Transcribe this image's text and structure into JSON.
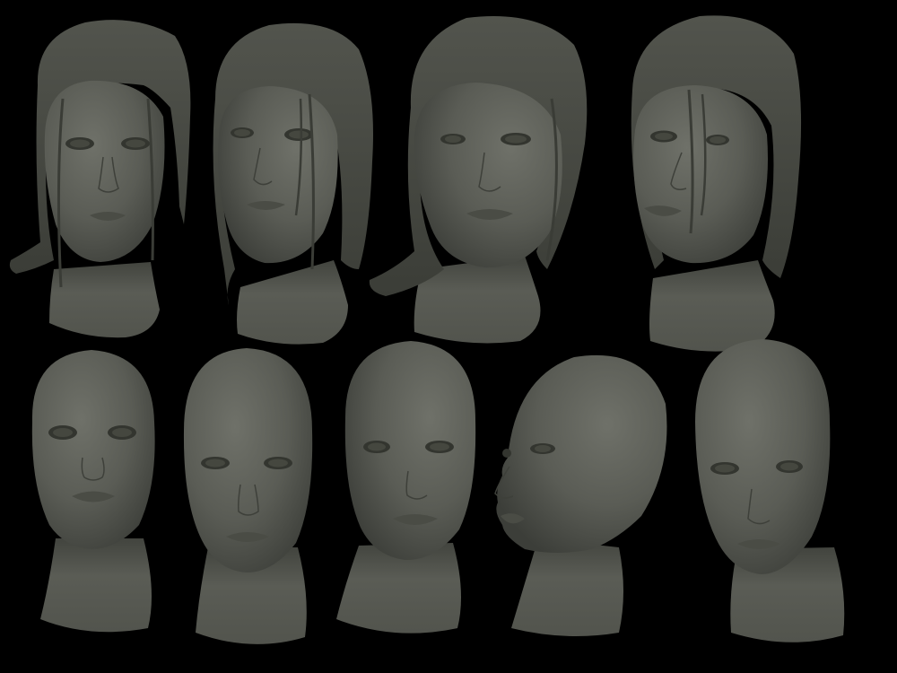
{
  "image": {
    "kind": "sculpt-reference-sheet",
    "background": "#000000",
    "material_color": "#5a5c55"
  },
  "rows": [
    {
      "name": "heads-with-hair",
      "count": 4,
      "views": [
        "front",
        "three-quarter-right",
        "three-quarter-right",
        "three-quarter-left"
      ]
    },
    {
      "name": "bald-heads",
      "count": 5,
      "views": [
        "front",
        "front",
        "three-quarter-left",
        "profile-left",
        "three-quarter-right"
      ]
    }
  ]
}
